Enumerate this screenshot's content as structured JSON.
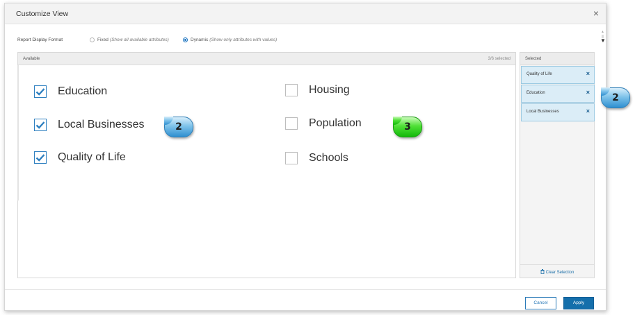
{
  "dialog": {
    "title": "Customize View",
    "close_glyph": "×"
  },
  "format": {
    "label": "Report Display Format",
    "options": [
      {
        "name": "Fixed",
        "hint": "(Show all available attributes)",
        "selected": false
      },
      {
        "name": "Dynamic",
        "hint": "(Show only attributes with values)",
        "selected": true
      }
    ]
  },
  "available": {
    "header": "Available",
    "count": "3/6 selected",
    "items": [
      {
        "label": "Education",
        "checked": true
      },
      {
        "label": "Local Businesses",
        "checked": true
      },
      {
        "label": "Quality of Life",
        "checked": true
      },
      {
        "label": "Housing",
        "checked": false
      },
      {
        "label": "Population",
        "checked": false
      },
      {
        "label": "Schools",
        "checked": false
      }
    ]
  },
  "selected": {
    "header": "Selected",
    "items": [
      {
        "label": "Quality of Life",
        "remove_glyph": "×"
      },
      {
        "label": "Education",
        "remove_glyph": "×"
      },
      {
        "label": "Local Businesses",
        "remove_glyph": "×"
      }
    ],
    "clear_label": "Clear Selection",
    "clear_icon": "trash-icon"
  },
  "buttons": {
    "cancel": "Cancel",
    "apply": "Apply"
  },
  "callouts": [
    {
      "text": "2",
      "color": "#4aa8e0"
    },
    {
      "text": "3",
      "color": "#2ccb1e"
    },
    {
      "text": "2",
      "color": "#4aa8e0"
    }
  ],
  "colors": {
    "accent": "#156fab",
    "selected_bg": "#dbedf7",
    "checkbox_check": "#2f80c0"
  }
}
